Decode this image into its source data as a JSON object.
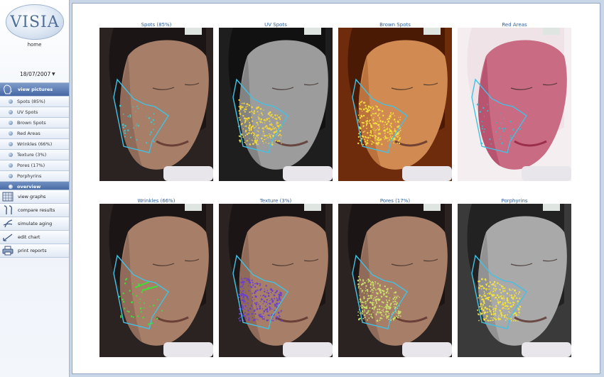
{
  "app": {
    "logo": "VISIA",
    "home_label": "home"
  },
  "date": {
    "value": "18/07/2007"
  },
  "view_pictures": {
    "label": "view pictures"
  },
  "menu_items": [
    {
      "label": "Spots (85%)"
    },
    {
      "label": "UV Spots"
    },
    {
      "label": "Brown Spots"
    },
    {
      "label": "Red Areas"
    },
    {
      "label": "Wrinkles (66%)"
    },
    {
      "label": "Texture (3%)"
    },
    {
      "label": "Pores (17%)"
    },
    {
      "label": "Porphyrins"
    }
  ],
  "overview": {
    "label": "overview"
  },
  "actions": [
    {
      "label": "view graphs",
      "icon": "graph-grid-icon"
    },
    {
      "label": "compare results",
      "icon": "compare-faces-icon"
    },
    {
      "label": "simulate aging",
      "icon": "aging-face-icon"
    },
    {
      "label": "edit chart",
      "icon": "edit-chart-icon"
    },
    {
      "label": "print reports",
      "icon": "printer-icon"
    }
  ],
  "thumbnails": [
    {
      "title": "Spots (85%)",
      "mode": "natural",
      "marks": "#42c4c8"
    },
    {
      "title": "UV Spots",
      "mode": "uv",
      "marks": "#f0d43a"
    },
    {
      "title": "Brown Spots",
      "mode": "brown",
      "marks": "#f2e03c"
    },
    {
      "title": "Red Areas",
      "mode": "red",
      "marks": "#3fb7c9"
    },
    {
      "title": "Wrinkles (66%)",
      "mode": "natural",
      "marks": "#3ee03a"
    },
    {
      "title": "Texture (3%)",
      "mode": "natural",
      "marks": "#6a3fd1"
    },
    {
      "title": "Pores (17%)",
      "mode": "natural",
      "marks": "#c9e06a"
    },
    {
      "title": "Porphyrins",
      "mode": "gray",
      "marks": "#f3e23a"
    }
  ],
  "colors": {
    "outline": "#43c1e4",
    "title": "#2d5f9c",
    "active": "#4667a5"
  }
}
